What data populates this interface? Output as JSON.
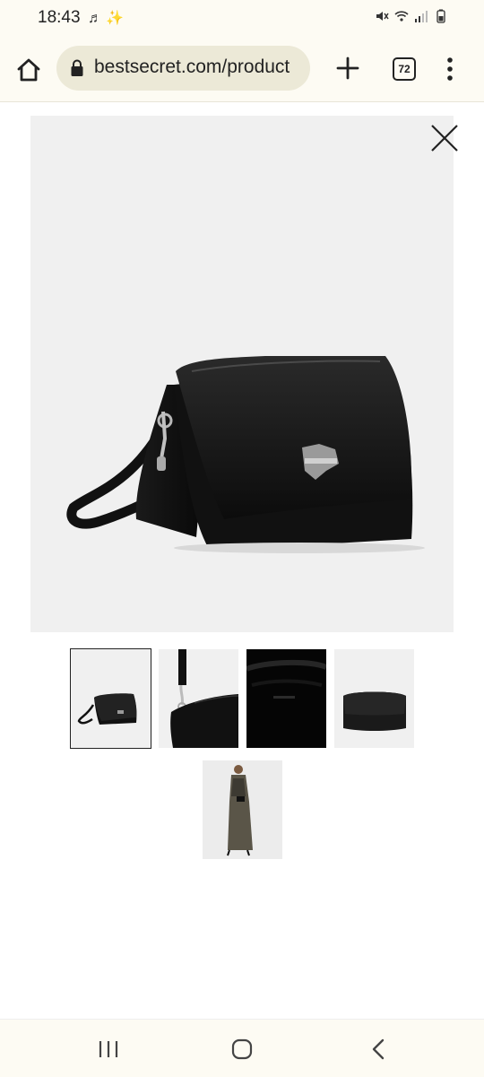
{
  "status_bar": {
    "time": "18:43",
    "left_icons": [
      "notification-icon",
      "magic-wand-icon"
    ],
    "right_icons": [
      "mute-icon",
      "wifi-icon",
      "signal-icon",
      "battery-icon"
    ]
  },
  "browser": {
    "url": "bestsecret.com/product",
    "tab_count": "72",
    "icons": [
      "home-icon",
      "lock-icon",
      "plus-icon",
      "tabs-icon",
      "more-vert-icon"
    ]
  },
  "gallery": {
    "close_icon": "close-icon",
    "main_image": "black leather crossbody bag with silver logo plate",
    "thumbnails": [
      {
        "label": "bag side view",
        "selected": true
      },
      {
        "label": "strap and clasp detail",
        "selected": false
      },
      {
        "label": "interior view",
        "selected": false
      },
      {
        "label": "back view",
        "selected": false
      },
      {
        "label": "model wearing bag",
        "selected": false
      }
    ]
  },
  "nav_bar": {
    "icons": [
      "recents-icon",
      "home-nav-icon",
      "back-icon"
    ]
  },
  "colors": {
    "chrome_bg": "#fdfbf3",
    "url_pill": "#ece9d7",
    "image_bg": "#f0f0f0"
  }
}
